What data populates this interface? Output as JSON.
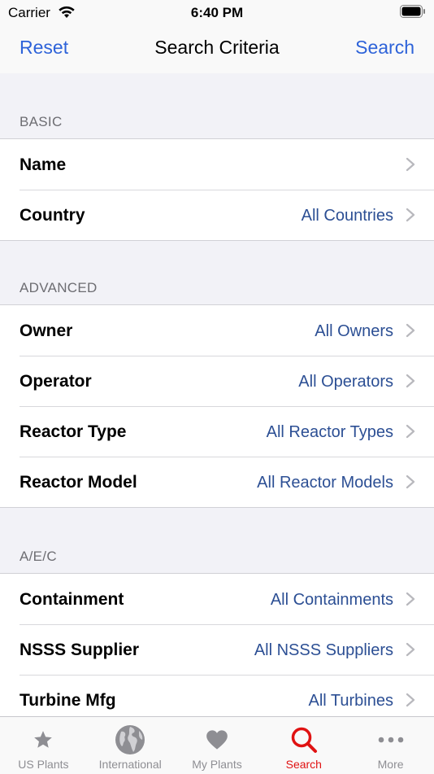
{
  "status_bar": {
    "carrier": "Carrier",
    "time": "6:40 PM"
  },
  "nav": {
    "reset": "Reset",
    "title": "Search Criteria",
    "search": "Search"
  },
  "sections": [
    {
      "header": "BASIC",
      "rows": [
        {
          "label": "Name",
          "value": ""
        },
        {
          "label": "Country",
          "value": "All Countries"
        }
      ]
    },
    {
      "header": "ADVANCED",
      "rows": [
        {
          "label": "Owner",
          "value": "All Owners"
        },
        {
          "label": "Operator",
          "value": "All Operators"
        },
        {
          "label": "Reactor Type",
          "value": "All Reactor Types"
        },
        {
          "label": "Reactor Model",
          "value": "All Reactor Models"
        }
      ]
    },
    {
      "header": "A/E/C",
      "rows": [
        {
          "label": "Containment",
          "value": "All Containments"
        },
        {
          "label": "NSSS Supplier",
          "value": "All NSSS Suppliers"
        },
        {
          "label": "Turbine Mfg",
          "value": "All Turbines"
        }
      ]
    }
  ],
  "tabs": [
    {
      "label": "US Plants",
      "icon": "star-icon",
      "active": false
    },
    {
      "label": "International",
      "icon": "globe-icon",
      "active": false
    },
    {
      "label": "My Plants",
      "icon": "heart-icon",
      "active": false
    },
    {
      "label": "Search",
      "icon": "search-icon",
      "active": true
    },
    {
      "label": "More",
      "icon": "more-icon",
      "active": false
    }
  ],
  "colors": {
    "accent": "#2e63d9",
    "value_text": "#2c4f94",
    "active_tab": "#e01212",
    "inactive_tab": "#8e8e93"
  }
}
